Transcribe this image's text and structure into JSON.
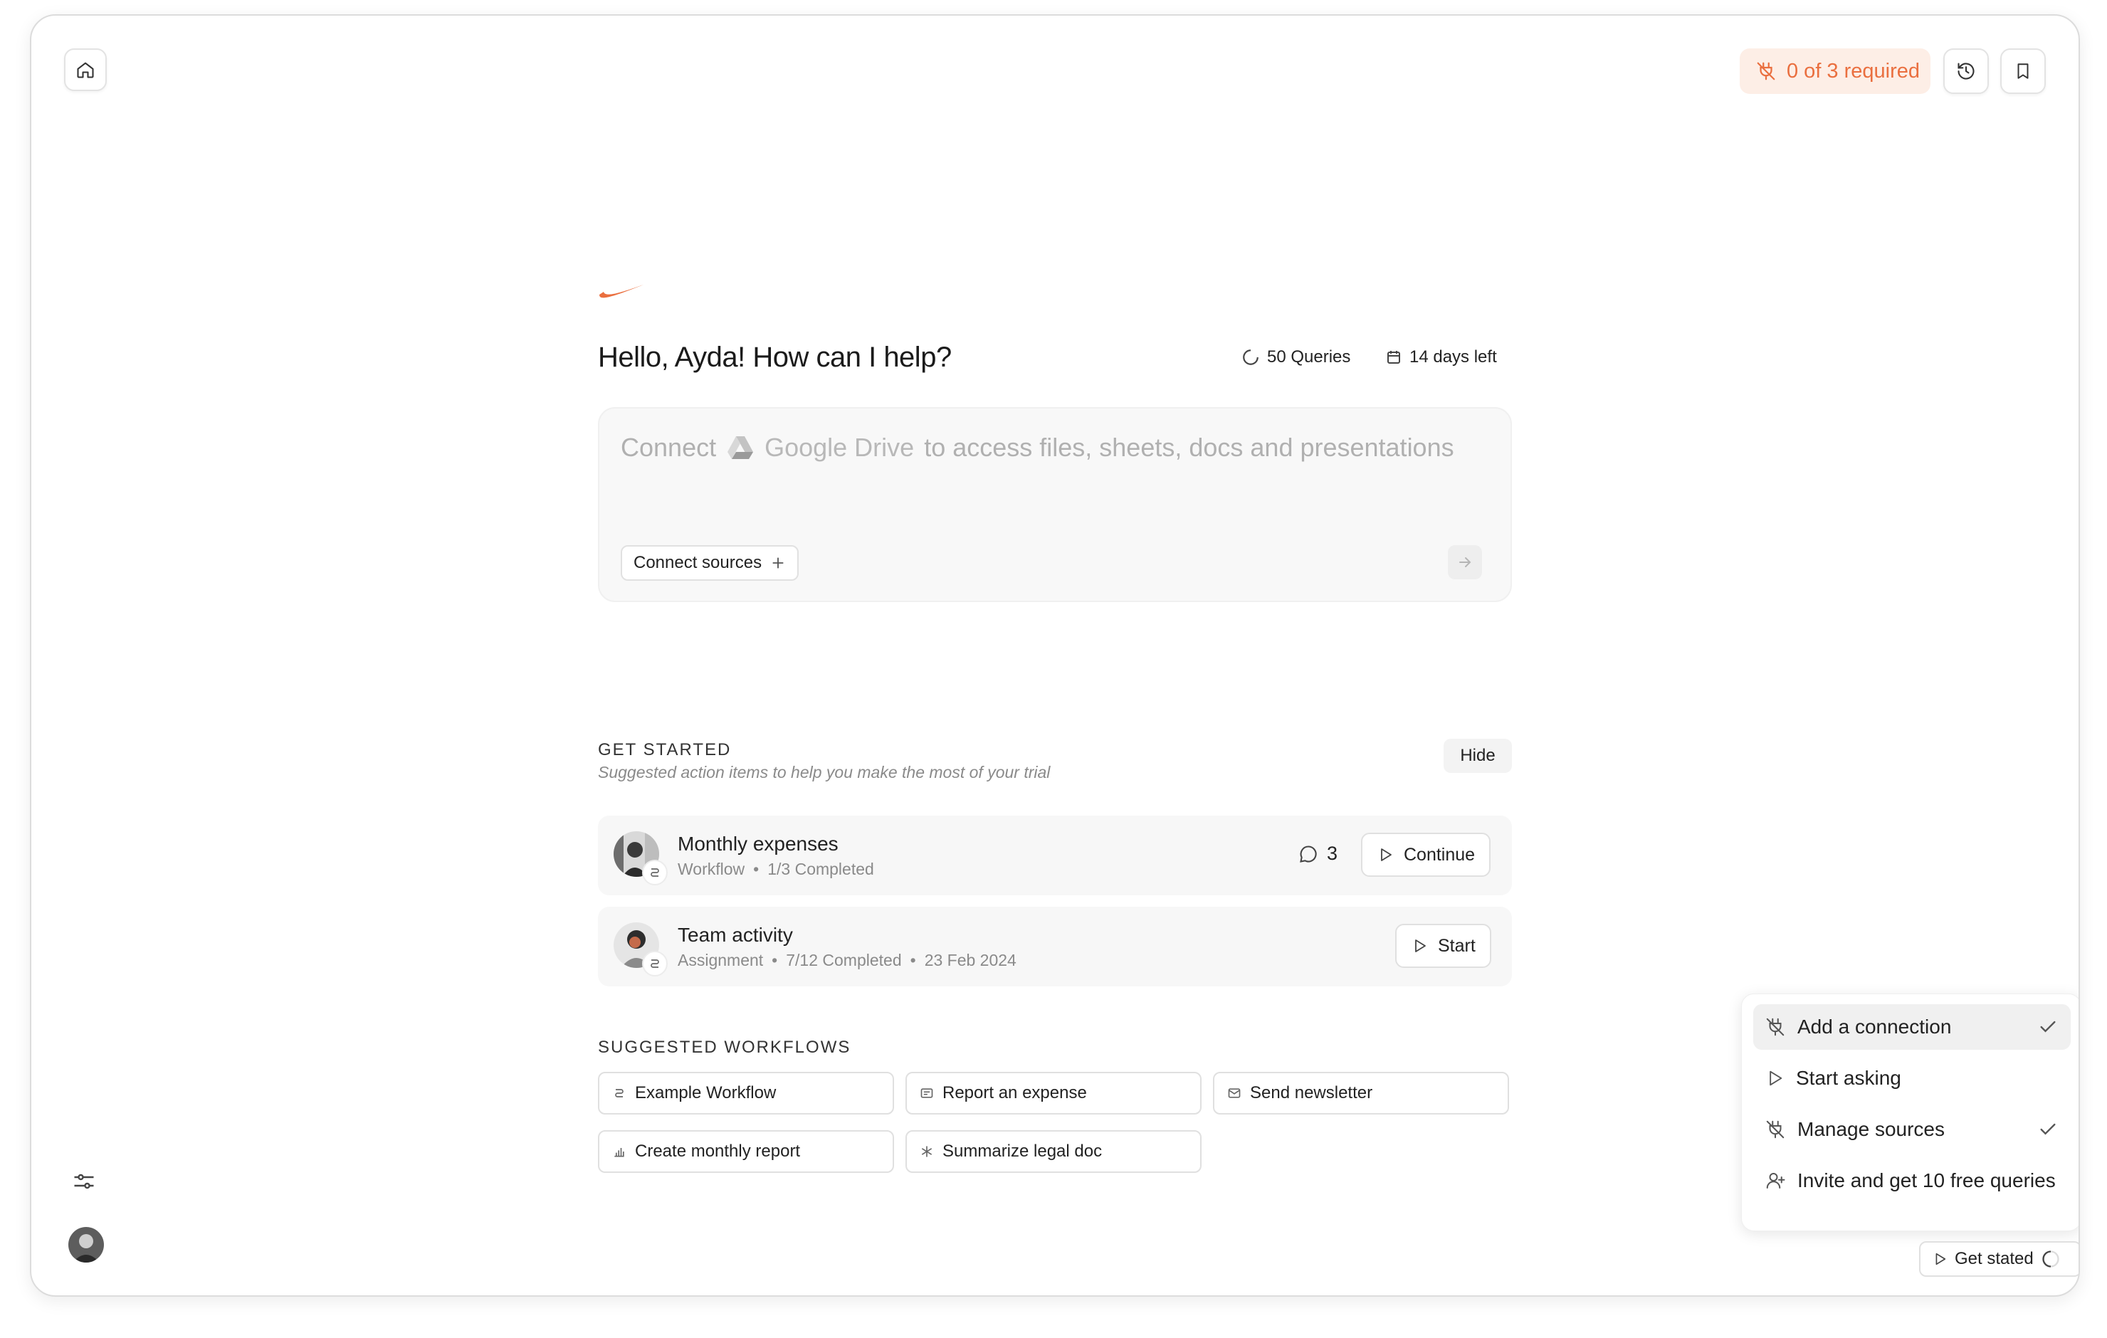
{
  "header": {
    "requirements_label": "0 of 3 required",
    "accent_color": "#ea6f3f"
  },
  "greeting": "Hello, Ayda! How can I help?",
  "stats": {
    "queries": "50 Queries",
    "days_left": "14 days left"
  },
  "composer": {
    "prefix": "Connect",
    "service": "Google Drive",
    "suffix": "to access files, sheets, docs and presentations",
    "connect_button": "Connect sources"
  },
  "get_started": {
    "title": "GET STARTED",
    "subtitle": "Suggested action items to help you make the most of your trial",
    "hide_label": "Hide",
    "tasks": [
      {
        "title": "Monthly expenses",
        "type": "Workflow",
        "progress": "1/3 Completed",
        "comments": "3",
        "action": "Continue"
      },
      {
        "title": "Team activity",
        "type": "Assignment",
        "progress": "7/12 Completed",
        "date": "23 Feb 2024",
        "action": "Start"
      }
    ]
  },
  "suggested_workflows": {
    "title": "SUGGESTED WORKFLOWS",
    "items": [
      {
        "label": "Example Workflow",
        "icon": "workflow-icon"
      },
      {
        "label": "Report an expense",
        "icon": "receipt-icon"
      },
      {
        "label": "Send newsletter",
        "icon": "mail-icon"
      },
      {
        "label": "Create monthly report",
        "icon": "bar-chart-icon"
      },
      {
        "label": "Summarize legal doc",
        "icon": "asterisk-icon"
      }
    ]
  },
  "checklist": {
    "items": [
      {
        "label": "Add a connection",
        "icon": "plug-icon",
        "done": true
      },
      {
        "label": "Start asking",
        "icon": "play-icon",
        "done": false
      },
      {
        "label": "Manage sources",
        "icon": "plug-icon",
        "done": true
      },
      {
        "label": "Invite and get 10 free queries",
        "icon": "user-plus-icon",
        "done": false
      }
    ],
    "button_label": "Get stated"
  }
}
